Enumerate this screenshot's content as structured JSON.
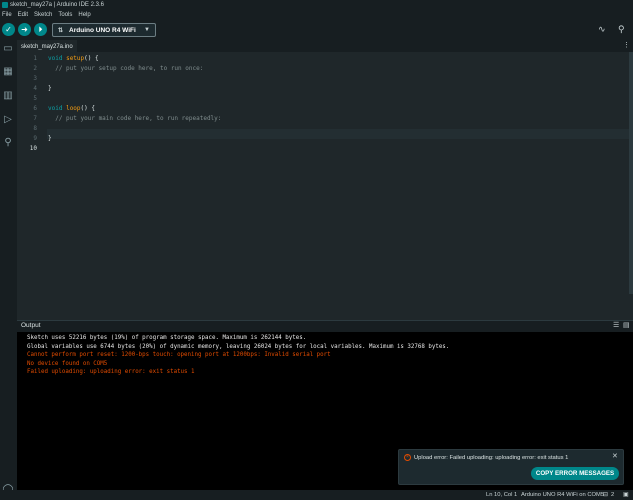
{
  "window": {
    "title": "sketch_may27a | Arduino IDE 2.3.6"
  },
  "menu": {
    "items": [
      "File",
      "Edit",
      "Sketch",
      "Tools",
      "Help"
    ]
  },
  "toolbar": {
    "board": "Arduino UNO R4 WiFi",
    "verify_icon": "check-icon",
    "upload_icon": "arrow-right-icon",
    "debug_icon": "debug-icon"
  },
  "tabs": [
    {
      "label": "sketch_may27a.ino"
    }
  ],
  "editor": {
    "line_numbers": [
      "1",
      "2",
      "3",
      "4",
      "5",
      "6",
      "7",
      "8",
      "9",
      "10"
    ],
    "active_line": "10",
    "lines": [
      {
        "kw": "void",
        "fn": "setup",
        "rest": "() {"
      },
      {
        "comment": "  // put your setup code here, to run once:"
      },
      {
        "text": ""
      },
      {
        "text": "}"
      },
      {
        "text": ""
      },
      {
        "kw": "void",
        "fn": "loop",
        "rest": "() {"
      },
      {
        "comment": "  // put your main code here, to run repeatedly:"
      },
      {
        "text": ""
      },
      {
        "text": "}"
      },
      {
        "text": ""
      }
    ]
  },
  "output": {
    "title": "Output",
    "lines": [
      {
        "text": "Sketch uses 52216 bytes (19%) of program storage space. Maximum is 262144 bytes.",
        "type": "normal"
      },
      {
        "text": "Global variables use 6744 bytes (20%) of dynamic memory, leaving 26024 bytes for local variables. Maximum is 32768 bytes.",
        "type": "normal"
      },
      {
        "text": "Cannot perform port reset: 1200-bps touch: opening port at 1200bps: Invalid serial port",
        "type": "err"
      },
      {
        "text": "No device found on COM5",
        "type": "err"
      },
      {
        "text": "Failed uploading: uploading error: exit status 1",
        "type": "err"
      }
    ]
  },
  "notification": {
    "message": "Upload error: Failed uploading: uploading error: exit status 1",
    "button": "COPY ERROR MESSAGES"
  },
  "status": {
    "position": "Ln 10, Col 1",
    "board_port": "Arduino UNO R4 WiFi on COM5",
    "notif_count": "2"
  },
  "colors": {
    "accent": "#00878a",
    "error": "#e34c00",
    "keyword": "#0ca1a6",
    "function": "#f39c12"
  }
}
